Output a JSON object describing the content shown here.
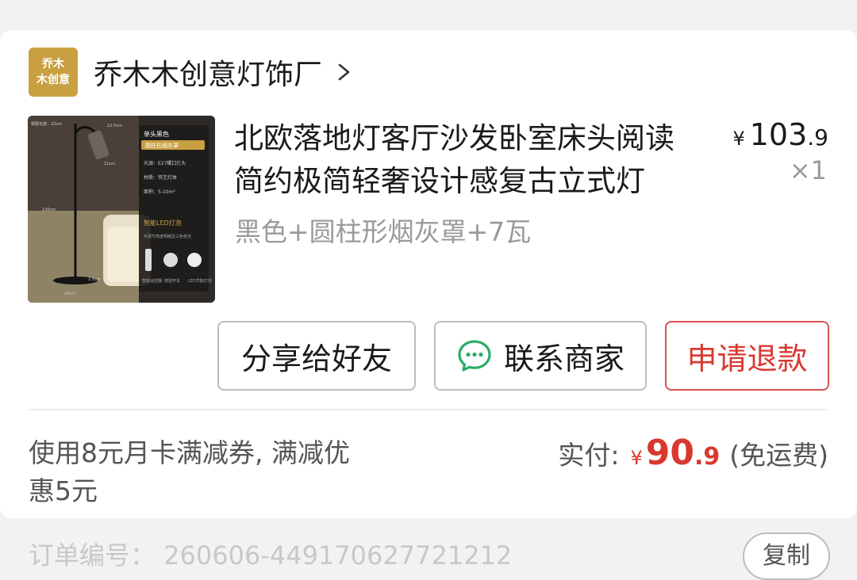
{
  "shop": {
    "logo_line1": "乔木",
    "logo_line2": "木创意",
    "name": "乔木木创意灯饰厂",
    "chevron_icon": "chevron-right-icon"
  },
  "product": {
    "image_icon": "floor-lamp-product-image",
    "image_text": {
      "tag1": "单头黑色",
      "tag2": "圆柱形烟灰罩",
      "spec1": "光源：E27螺口灯头",
      "spec2": "材质：铁艺灯体",
      "spec3": "面积：5-10m²",
      "led": "智能LED灯泡",
      "led_sub": "可调节亮度明暗及三色变光",
      "dim_top": "臂展长度：22cm",
      "dim_shade": "12.5cm",
      "dim_w": "11cm",
      "dim_h": "130cm",
      "dim_base_h": "2.5cm",
      "dim_base": "25cm",
      "icon1": "智能遥控器",
      "icon2": "按钮开关",
      "icon3": "LED节能灯泡"
    },
    "title": "北欧落地灯客厅沙发卧室床头阅读简约极简轻奢设计感复古立式灯",
    "sku": "黑色+圆柱形烟灰罩+7瓦",
    "price_currency": "¥",
    "price_int": "103",
    "price_dec": ".9",
    "quantity": "×1"
  },
  "actions": {
    "share": "分享给好友",
    "contact": "联系商家",
    "contact_icon": "wechat-chat-icon",
    "refund": "申请退款"
  },
  "summary": {
    "discount_text": "使用8元月卡满减券, 满减优惠5元",
    "paid_label": "实付:",
    "paid_currency": "¥",
    "paid_int": "90",
    "paid_dec": ".9",
    "shipping": "(免运费)"
  },
  "order": {
    "number_text": "订单编号：  260606-449170627721212",
    "copy": "复制"
  },
  "colors": {
    "accent_red": "#d9382f",
    "logo_gold": "#c9a041",
    "wechat_green": "#2aae67"
  }
}
